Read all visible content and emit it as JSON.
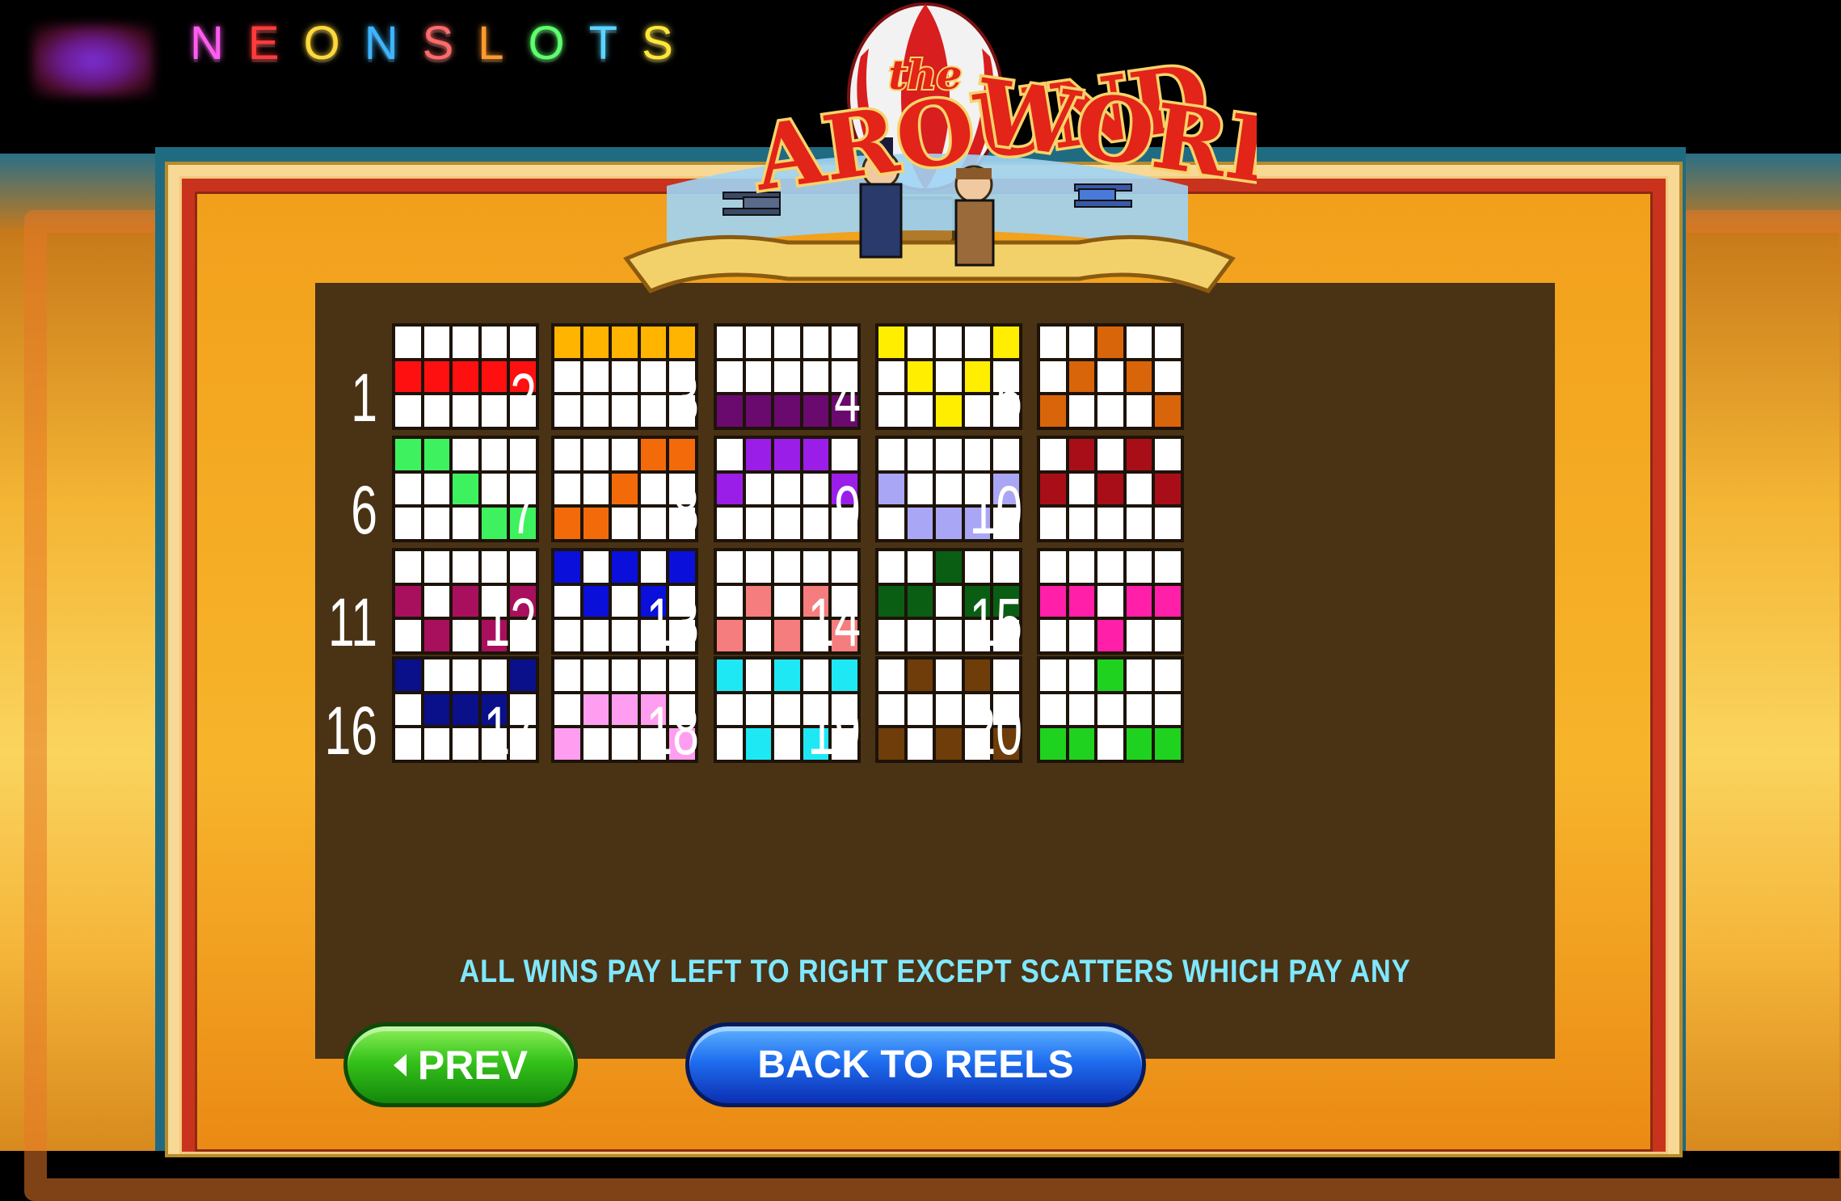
{
  "brand": {
    "letters": [
      {
        "ch": "N",
        "color": "#ff5cf0"
      },
      {
        "ch": "E",
        "color": "#ff3b3b"
      },
      {
        "ch": "O",
        "color": "#ffd83a"
      },
      {
        "ch": "N",
        "color": "#3fb4ff"
      },
      {
        "ch": "S",
        "color": "#ff6a6a"
      },
      {
        "ch": "L",
        "color": "#ff9a2e"
      },
      {
        "ch": "O",
        "color": "#5cff6c"
      },
      {
        "ch": "T",
        "color": "#5ad5ff"
      },
      {
        "ch": "S",
        "color": "#ffe63a"
      }
    ]
  },
  "game_logo": {
    "word1": "AROUND",
    "word2": "the",
    "word3": "WORLD"
  },
  "paylines": [
    {
      "num": "1",
      "color": "#ff1010",
      "rows": [
        1,
        1,
        1,
        1,
        1
      ]
    },
    {
      "num": "2",
      "color": "#ffb400",
      "rows": [
        0,
        0,
        0,
        0,
        0
      ]
    },
    {
      "num": "3",
      "color": "#6a0a6e",
      "rows": [
        2,
        2,
        2,
        2,
        2
      ]
    },
    {
      "num": "4",
      "color": "#ffee00",
      "rows": [
        0,
        1,
        2,
        1,
        0
      ]
    },
    {
      "num": "5",
      "color": "#d9650a",
      "rows": [
        2,
        1,
        0,
        1,
        2
      ]
    },
    {
      "num": "6",
      "color": "#3df25e",
      "rows": [
        0,
        0,
        1,
        2,
        2
      ]
    },
    {
      "num": "7",
      "color": "#f26a0a",
      "rows": [
        2,
        2,
        1,
        0,
        0
      ]
    },
    {
      "num": "8",
      "color": "#9b1ee8",
      "rows": [
        1,
        0,
        0,
        0,
        1
      ]
    },
    {
      "num": "9",
      "color": "#a9a6f5",
      "rows": [
        1,
        2,
        2,
        2,
        1
      ]
    },
    {
      "num": "10",
      "color": "#a80e18",
      "rows": [
        1,
        0,
        1,
        0,
        1
      ]
    },
    {
      "num": "11",
      "color": "#a8105e",
      "rows": [
        1,
        2,
        1,
        2,
        1
      ]
    },
    {
      "num": "12",
      "color": "#0a10d9",
      "rows": [
        0,
        1,
        0,
        1,
        0
      ]
    },
    {
      "num": "13",
      "color": "#f57d7d",
      "rows": [
        2,
        1,
        2,
        1,
        2
      ]
    },
    {
      "num": "14",
      "color": "#0a5e14",
      "rows": [
        1,
        1,
        0,
        1,
        1
      ]
    },
    {
      "num": "15",
      "color": "#ff1fa8",
      "rows": [
        1,
        1,
        2,
        1,
        1
      ]
    },
    {
      "num": "16",
      "color": "#0a0f8a",
      "rows": [
        0,
        1,
        1,
        1,
        0
      ]
    },
    {
      "num": "17",
      "color": "#ff9ef0",
      "rows": [
        2,
        1,
        1,
        1,
        2
      ]
    },
    {
      "num": "18",
      "color": "#1fe8f5",
      "rows": [
        0,
        2,
        0,
        2,
        0
      ]
    },
    {
      "num": "19",
      "color": "#6e3d0a",
      "rows": [
        2,
        0,
        2,
        0,
        2
      ]
    },
    {
      "num": "20",
      "color": "#1fd21f",
      "rows": [
        2,
        2,
        0,
        2,
        2
      ]
    }
  ],
  "footer_note": "ALL WINS PAY LEFT TO RIGHT EXCEPT SCATTERS WHICH PAY ANY",
  "buttons": {
    "prev": "PREV",
    "back": "BACK TO REELS"
  }
}
